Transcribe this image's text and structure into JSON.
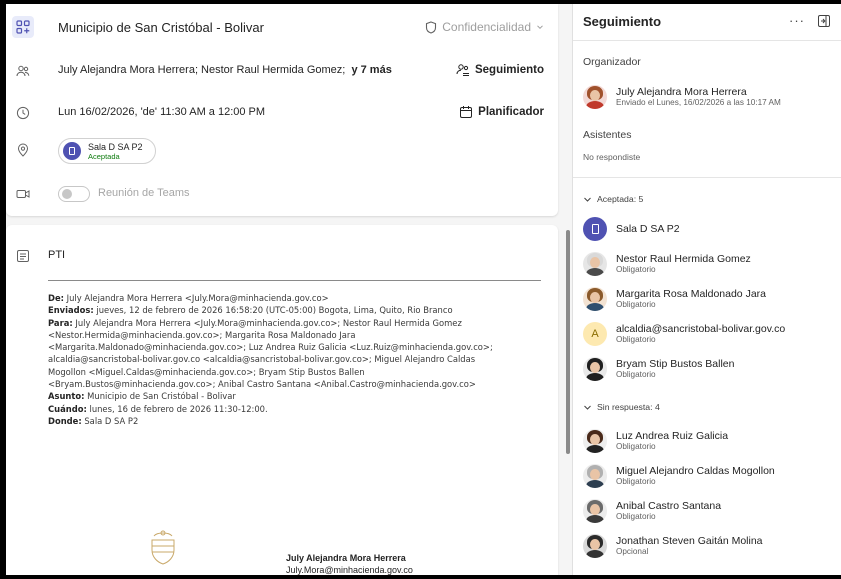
{
  "meeting": {
    "title": "Municipio de San Cristóbal - Bolivar",
    "confidentiality": "Confidencialidad",
    "attendees_text": "July Alejandra Mora Herrera;  Nestor Raul Hermida Gomez;",
    "attendees_more": "y 7 más",
    "tracking_label": "Seguimiento",
    "datetime": "Lun 16/02/2026, 'de' 11:30 AM a 12:00 PM",
    "scheduler_label": "Planificador",
    "room": {
      "name": "Sala D SA P2",
      "status": "Aceptada"
    },
    "teams_label": "Reunión de Teams",
    "subject_line": "PTI"
  },
  "email": {
    "lines": [
      {
        "label": "De:",
        "text": " July Alejandra Mora Herrera <July.Mora@minhacienda.gov.co>"
      },
      {
        "label": "Enviados:",
        "text": " jueves, 12 de febrero de 2026 16:58:20 (UTC-05:00) Bogota, Lima, Quito, Rio Branco"
      },
      {
        "label": "Para:",
        "text": " July Alejandra Mora Herrera <July.Mora@minhacienda.gov.co>; Nestor Raul Hermida Gomez"
      },
      {
        "label": "",
        "text": "<Nestor.Hermida@minhacienda.gov.co>; Margarita Rosa Maldonado Jara"
      },
      {
        "label": "",
        "text": "<Margarita.Maldonado@minhacienda.gov.co>; Luz Andrea Ruiz Galicia <Luz.Ruiz@minhacienda.gov.co>;"
      },
      {
        "label": "",
        "text": "alcaldia@sancristobal-bolivar.gov.co <alcaldia@sancristobal-bolivar.gov.co>; Miguel Alejandro Caldas"
      },
      {
        "label": "",
        "text": "Mogollon <Miguel.Caldas@minhacienda.gov.co>; Bryam Stip Bustos Ballen"
      },
      {
        "label": "",
        "text": "<Bryam.Bustos@minhacienda.gov.co>; Anibal Castro Santana <Anibal.Castro@minhacienda.gov.co>"
      },
      {
        "label": "Asunto:",
        "text": " Municipio de San Cristóbal - Bolivar"
      },
      {
        "label": "Cuándo:",
        "text": " lunes, 16 de febrero de 2026 11:30-12:00."
      },
      {
        "label": "Donde:",
        "text": " Sala D SA P2"
      }
    ],
    "signature_name": "July Alejandra Mora Herrera",
    "signature_email": "July.Mora@minhacienda.gov.co"
  },
  "panel": {
    "title": "Seguimiento",
    "more": "···",
    "organizer_heading": "Organizador",
    "organizer": {
      "name": "July Alejandra Mora Herrera",
      "sub": "Enviado el Lunes, 16/02/2026 a las 10:17 AM"
    },
    "attendees_heading": "Asistentes",
    "no_response": "No respondiste",
    "accepted_group": "Aceptada: 5",
    "accepted": [
      {
        "name": "Sala D SA P2",
        "sub": ""
      },
      {
        "name": "Nestor Raul Hermida Gomez",
        "sub": "Obligatorio"
      },
      {
        "name": "Margarita Rosa Maldonado Jara",
        "sub": "Obligatorio"
      },
      {
        "name": "alcaldia@sancristobal-bolivar.gov.co",
        "sub": "Obligatorio",
        "initial": "A"
      },
      {
        "name": "Bryam Stip Bustos Ballen",
        "sub": "Obligatorio"
      }
    ],
    "noresp_group": "Sin respuesta: 4",
    "noresp": [
      {
        "name": "Luz Andrea Ruiz Galicia",
        "sub": "Obligatorio"
      },
      {
        "name": "Miguel Alejandro Caldas Mogollon",
        "sub": "Obligatorio"
      },
      {
        "name": "Anibal Castro Santana",
        "sub": "Obligatorio"
      },
      {
        "name": "Jonathan Steven Gaitán Molina",
        "sub": "Opcional"
      }
    ]
  },
  "colors": {
    "accent": "#4f52b2",
    "accepted_green": "#107c10"
  }
}
